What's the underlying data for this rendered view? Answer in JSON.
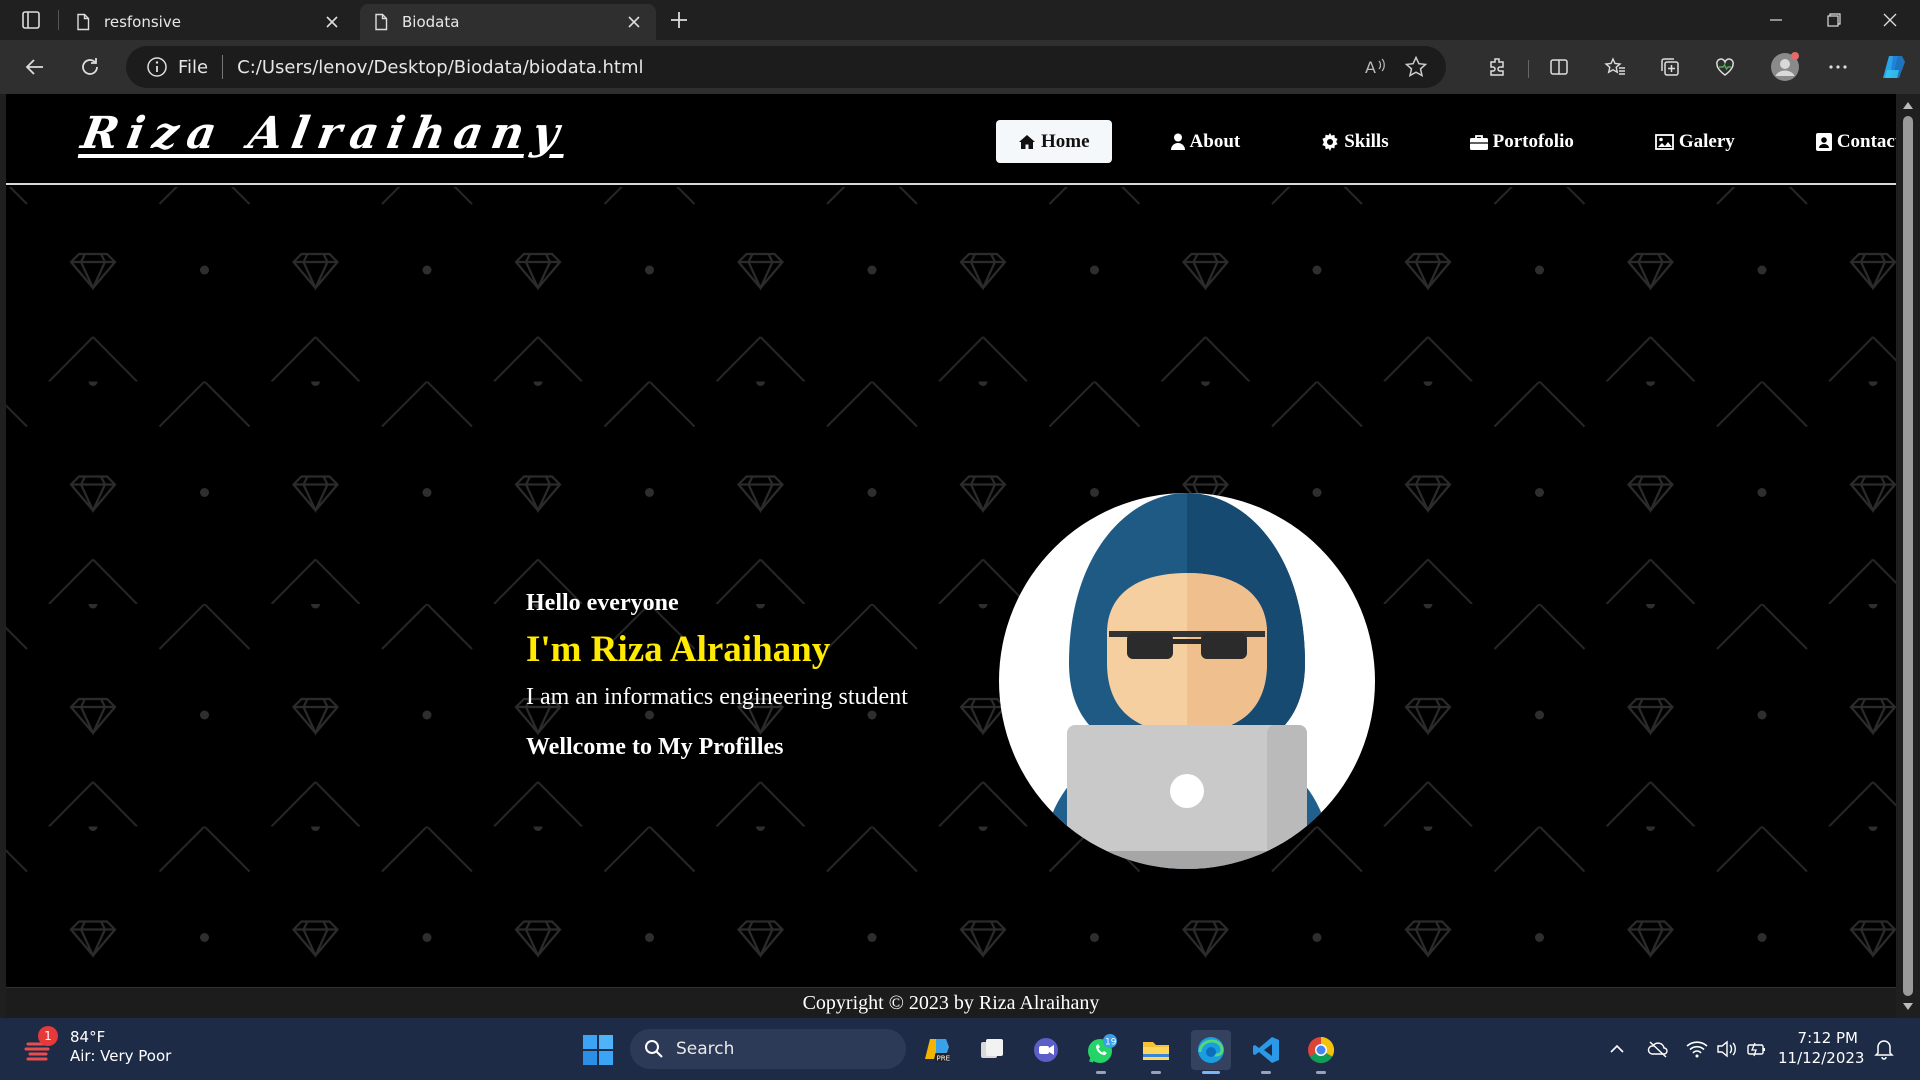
{
  "browser": {
    "tabs": [
      {
        "title": "resfonsive",
        "active": false
      },
      {
        "title": "Biodata",
        "active": true
      }
    ],
    "address": {
      "scheme_label": "File",
      "url": "C:/Users/lenov/Desktop/Biodata/biodata.html"
    }
  },
  "site": {
    "logo": "Riza Alraihany",
    "nav": [
      {
        "label": "Home",
        "icon": "home-icon",
        "active": true
      },
      {
        "label": "About",
        "icon": "user-icon",
        "active": false
      },
      {
        "label": "Skills",
        "icon": "gear-icon",
        "active": false
      },
      {
        "label": "Portofolio",
        "icon": "briefcase-icon",
        "active": false
      },
      {
        "label": "Galery",
        "icon": "image-icon",
        "active": false
      },
      {
        "label": "Contact",
        "icon": "contact-card-icon",
        "active": false
      }
    ],
    "hero": {
      "greeting": "Hello everyone",
      "name": "I'm Riza Alraihany",
      "description": "I am an informatics engineering student",
      "welcome": "Wellcome to My Profilles",
      "avatar": "hooded-hacker-laptop-avatar"
    },
    "footer": "Copyright © 2023 by Riza Alraihany"
  },
  "taskbar": {
    "weather": {
      "badge": "1",
      "temp": "84°F",
      "condition": "Air: Very Poor"
    },
    "search_placeholder": "Search",
    "apps": [
      {
        "name": "copilot-preview-icon",
        "badge": ""
      },
      {
        "name": "task-view-icon",
        "badge": ""
      },
      {
        "name": "teams-meet-icon",
        "badge": ""
      },
      {
        "name": "whatsapp-icon",
        "badge": "19"
      },
      {
        "name": "file-explorer-icon",
        "badge": ""
      },
      {
        "name": "edge-icon",
        "badge": ""
      },
      {
        "name": "vscode-icon",
        "badge": ""
      },
      {
        "name": "chrome-icon",
        "badge": ""
      }
    ],
    "clock": {
      "time": "7:12 PM",
      "date": "11/12/2023"
    }
  },
  "colors": {
    "page_bg": "#000000",
    "accent_name": "#ffea00",
    "nav_active_bg": "#f5f8fb",
    "taskbar_bg": "#1e2b47"
  }
}
